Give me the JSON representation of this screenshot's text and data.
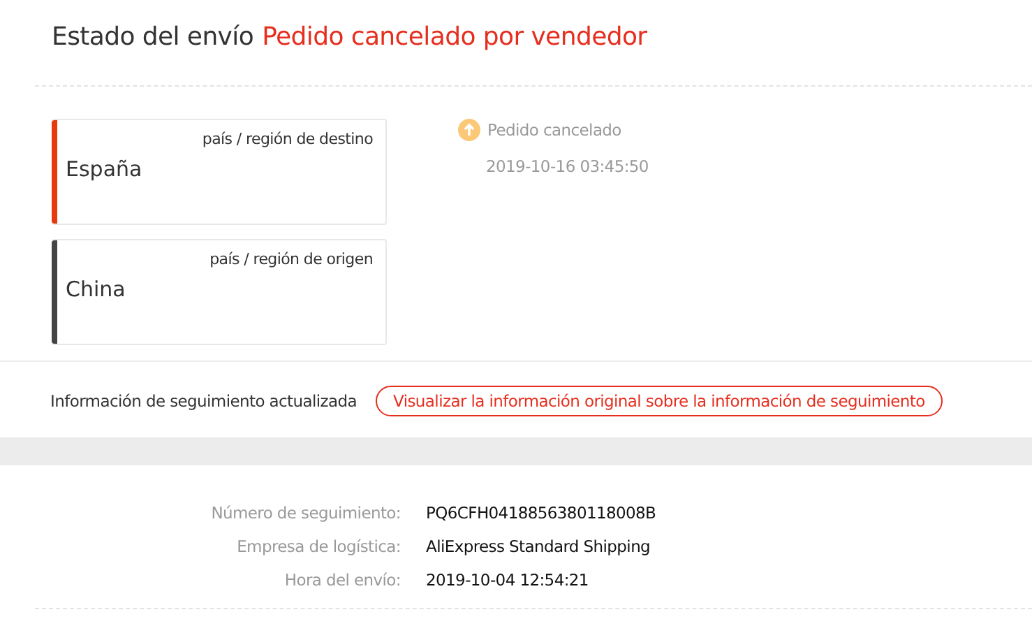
{
  "status": {
    "label": "Estado del envío",
    "value": "Pedido cancelado por vendedor"
  },
  "locations": [
    {
      "caption": "país / región de destino",
      "country": "España",
      "color": "#e8390e"
    },
    {
      "caption": "país / región de origen",
      "country": "China",
      "color": "#444444"
    }
  ],
  "events": [
    {
      "title": "Pedido cancelado",
      "time": "2019-10-16 03:45:50"
    }
  ],
  "update": {
    "text": "Información de seguimiento actualizada",
    "link": "Visualizar la información original sobre la información de seguimiento"
  },
  "details": [
    {
      "label": "Número de seguimiento:",
      "value": "PQ6CFH0418856380118008B"
    },
    {
      "label": "Empresa de logística:",
      "value": "AliExpress Standard Shipping"
    },
    {
      "label": "Hora del envío:",
      "value": "2019-10-04 12:54:21"
    }
  ]
}
